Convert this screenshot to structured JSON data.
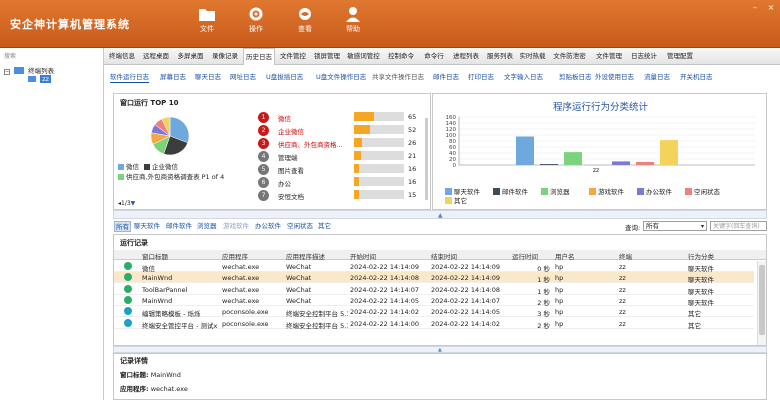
{
  "app_title": "安企神计算机管理系统",
  "header_buttons": [
    {
      "label": "文件",
      "icon": "folder-icon"
    },
    {
      "label": "操作",
      "icon": "gear-icon"
    },
    {
      "label": "查看",
      "icon": "eye-icon"
    },
    {
      "label": "帮助",
      "icon": "user-icon"
    }
  ],
  "window_controls": {
    "minimize": "–",
    "close": "×"
  },
  "left_panel": {
    "search": "搜索",
    "tree_root": "终端列表",
    "tree_child": "zz"
  },
  "menu_tabs": [
    "终端信息",
    "远程桌面",
    "多屏桌面",
    "录像记录",
    "历史日志",
    "文件管控",
    "锁屏管理",
    "敏感词管控",
    "控制命令",
    "命令行",
    "进程列表",
    "服务列表",
    "实时热载",
    "文件防泄密",
    "文件管理",
    "日志统计",
    "管理配置"
  ],
  "active_menu": 4,
  "sub_tabs": [
    "软件运行日志",
    "屏幕日志",
    "聊天日志",
    "网址日志",
    "U盘拔插日志",
    "U盘文件操作日志",
    "共享文件操作日志",
    "邮件日志",
    "打印日志",
    "文字输入日志",
    "剪贴板日志",
    "外设使用日志",
    "流量日志",
    "开关机日志"
  ],
  "window_ranking": {
    "title": "窗口运行 TOP 10",
    "pie_legend": [
      "微信",
      "企业微信",
      "供应商,外包商资格调查表 P1 of 4"
    ],
    "pager": "1/3",
    "items": [
      {
        "rank": "1",
        "label": "微信",
        "value": 65,
        "value_text": "65"
      },
      {
        "rank": "2",
        "label": "企业微信",
        "value": 52,
        "value_text": "52"
      },
      {
        "rank": "3",
        "label": "供应商、外包商资格...",
        "value": 26,
        "value_text": "26"
      },
      {
        "rank": "4",
        "label": "管理端",
        "value": 21,
        "value_text": "21"
      },
      {
        "rank": "5",
        "label": "图片查看",
        "value": 16,
        "value_text": "16"
      },
      {
        "rank": "6",
        "label": "办公",
        "value": 16,
        "value_text": "16"
      },
      {
        "rank": "7",
        "label": "安恒文档",
        "value": 15,
        "value_text": "15"
      }
    ]
  },
  "chart_data": {
    "type": "bar",
    "title": "程序运行行为分类统计",
    "categories": [
      "zz"
    ],
    "ylim": [
      0,
      160
    ],
    "yticks": [
      "160",
      "140",
      "120",
      "100",
      "80",
      "60",
      "40",
      "20",
      "0"
    ],
    "series": [
      {
        "name": "聊天软件",
        "values": [
          95
        ],
        "color": "#6fa8dc"
      },
      {
        "name": "邮件软件",
        "values": [
          3
        ],
        "color": "#3d4a5c"
      },
      {
        "name": "浏览器",
        "values": [
          43
        ],
        "color": "#7dd37d"
      },
      {
        "name": "游戏软件",
        "values": [
          0
        ],
        "color": "#f4a742"
      },
      {
        "name": "办公软件",
        "values": [
          12
        ],
        "color": "#7a7ad6"
      },
      {
        "name": "空闲状态",
        "values": [
          10
        ],
        "color": "#f08080"
      },
      {
        "name": "其它",
        "values": [
          83
        ],
        "color": "#f3d35c"
      }
    ]
  },
  "filters": [
    {
      "label": "所有",
      "state": "active"
    },
    {
      "label": "聊天软件",
      "state": "enabled"
    },
    {
      "label": "邮件软件",
      "state": "enabled"
    },
    {
      "label": "浏览器",
      "state": "enabled"
    },
    {
      "label": "游戏软件",
      "state": "disabled"
    },
    {
      "label": "办公软件",
      "state": "enabled"
    },
    {
      "label": "空闲状态",
      "state": "enabled"
    },
    {
      "label": "其它",
      "state": "enabled"
    }
  ],
  "query": {
    "label": "查询:",
    "selected": "所有",
    "placeholder": "关键字(回车查询)"
  },
  "records": {
    "title": "运行记录",
    "columns": [
      "窗口标题",
      "应用程序",
      "应用程序描述",
      "开始时间",
      "结束时间",
      "运行时间",
      "用户名",
      "终端",
      "行为分类"
    ],
    "rows": [
      {
        "icon": "wechat-icon",
        "cells": [
          "微信",
          "wechat.exe",
          "WeChat",
          "2024-02-22 14:14:09",
          "2024-02-22 14:14:09",
          "0 秒",
          "hp",
          "zz",
          "聊天软件"
        ]
      },
      {
        "icon": "wechat-icon",
        "cells": [
          "MainWnd",
          "wechat.exe",
          "WeChat",
          "2024-02-22 14:14:08",
          "2024-02-22 14:14:09",
          "1 秒",
          "hp",
          "zz",
          "聊天软件"
        ],
        "selected": true
      },
      {
        "icon": "wechat-icon",
        "cells": [
          "ToolBarPannel",
          "wechat.exe",
          "WeChat",
          "2024-02-22 14:14:07",
          "2024-02-22 14:14:08",
          "1 秒",
          "hp",
          "zz",
          "聊天软件"
        ]
      },
      {
        "icon": "wechat-icon",
        "cells": [
          "MainWnd",
          "wechat.exe",
          "WeChat",
          "2024-02-22 14:14:05",
          "2024-02-22 14:14:07",
          "2 秒",
          "hp",
          "zz",
          "聊天软件"
        ]
      },
      {
        "icon": "poconsole-icon",
        "cells": [
          "编辑策略模板 - 烁烁",
          "poconsole.exe",
          "终端安全控制平台 5.1",
          "2024-02-22 14:14:02",
          "2024-02-22 14:14:05",
          "3 秒",
          "hp",
          "zz",
          "其它"
        ]
      },
      {
        "icon": "poconsole-icon",
        "cells": [
          "终端安全管控平台 - 测试x",
          "poconsole.exe",
          "终端安全控制平台 5.1",
          "2024-02-22 14:14:00",
          "2024-02-22 14:14:02",
          "2 秒",
          "hp",
          "zz",
          "其它"
        ]
      }
    ]
  },
  "details": {
    "title": "记录详情",
    "fields": [
      {
        "label": "窗口标题:",
        "value": "MainWnd"
      },
      {
        "label": "应用程序:",
        "value": "wechat.exe"
      }
    ]
  },
  "colors": {
    "header": "#d8692a",
    "link": "#1a4fa8",
    "rank_badge": "#c71b1b",
    "bar": "#f5a623",
    "selected_row": "#fbe8c8"
  }
}
